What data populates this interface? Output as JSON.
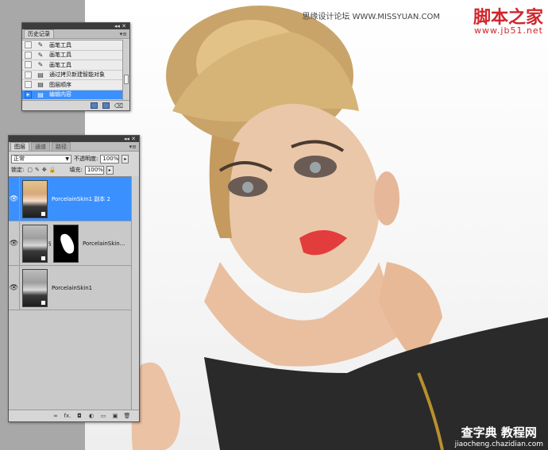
{
  "watermark_top": {
    "small_text": "思缘设计论坛 WWW.MISSYUAN.COM",
    "brand": "脚本之家",
    "url": "www.jb51.net"
  },
  "watermark_bottom": {
    "brand": "查字典 教程网",
    "url": "jiaocheng.chazidian.com"
  },
  "history_panel": {
    "tab_label": "历史记录",
    "menu_icon": "panel-menu-icon",
    "items": [
      {
        "label": "画笔工具",
        "icon": "brush-icon"
      },
      {
        "label": "画笔工具",
        "icon": "brush-icon"
      },
      {
        "label": "画笔工具",
        "icon": "brush-icon"
      },
      {
        "label": "通过拷贝新建智能对象",
        "icon": "document-icon"
      },
      {
        "label": "图层顺序",
        "icon": "document-icon"
      },
      {
        "label": "编辑内容",
        "icon": "document-icon",
        "selected": true
      }
    ]
  },
  "layers_panel": {
    "tabs": [
      {
        "label": "图层",
        "active": true
      },
      {
        "label": "通道",
        "active": false
      },
      {
        "label": "路径",
        "active": false
      }
    ],
    "blend_mode": "正常",
    "opacity_label": "不透明度:",
    "opacity_value": "100%",
    "lock_label": "锁定:",
    "fill_label": "填充:",
    "fill_value": "100%",
    "layers": [
      {
        "name": "PorcelainSkin1 副本 2",
        "thumb": "color",
        "selected": true,
        "has_mask": false
      },
      {
        "name": "PorcelainSkin...",
        "thumb": "gray",
        "selected": false,
        "has_mask": true
      },
      {
        "name": "PorcelainSkin1",
        "thumb": "gray",
        "selected": false,
        "has_mask": false
      }
    ],
    "footer_icons": [
      "link-layers-icon",
      "fx-icon",
      "add-mask-icon",
      "adjustment-icon",
      "group-icon",
      "new-layer-icon",
      "trash-icon"
    ],
    "footer_glyphs": [
      "∞",
      "fx.",
      "◘",
      "◐",
      "▭",
      "▣",
      "🗑"
    ]
  },
  "colors": {
    "selection": "#3b90ff",
    "panel_bg": "#d6d6d6",
    "brand_red": "#d0262b"
  }
}
